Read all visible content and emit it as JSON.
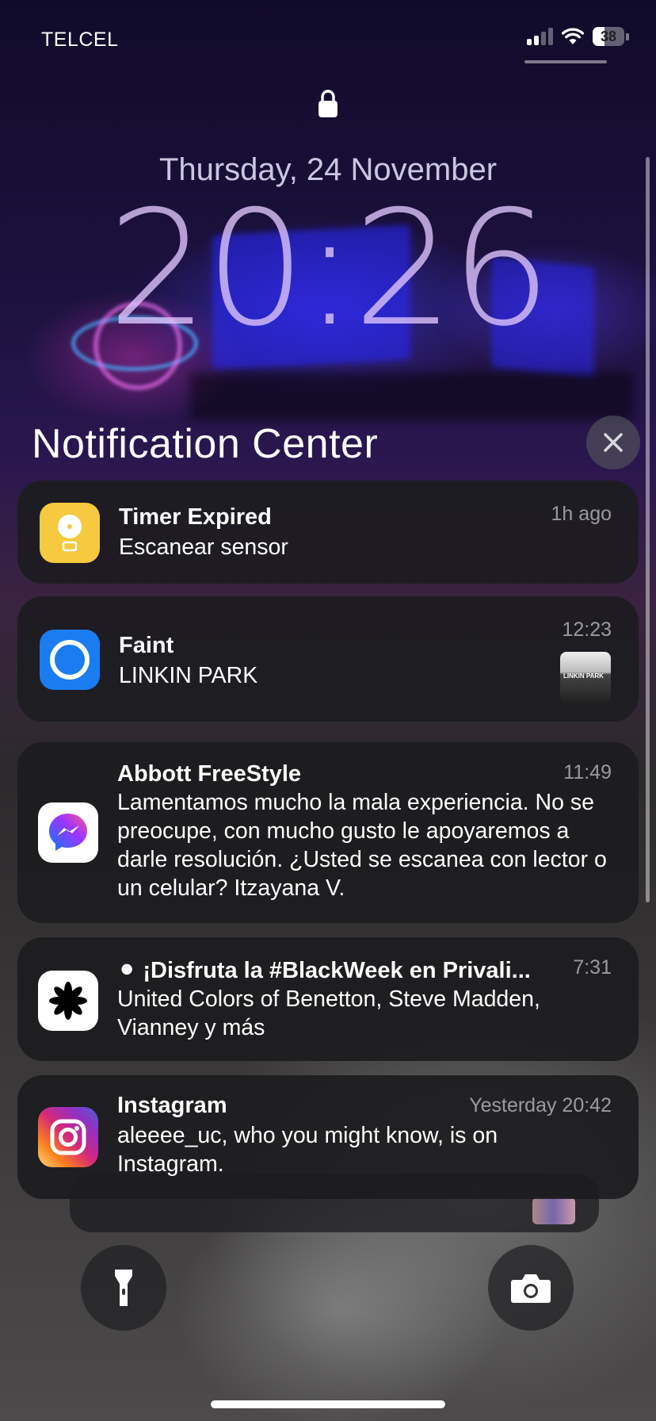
{
  "status_bar": {
    "carrier": "TELCEL",
    "signal_bars": 2,
    "signal_total": 4,
    "battery_level": "38"
  },
  "lock_screen": {
    "date": "Thursday, 24 November",
    "time": "20:26"
  },
  "notification_center": {
    "title": "Notification Center",
    "notifications": [
      {
        "app_icon": "clock-icon",
        "title": "Timer Expired",
        "time": "1h ago",
        "body": "Escanear sensor"
      },
      {
        "app_icon": "shazam-icon",
        "title": "Faint",
        "time": "12:23",
        "body": "LINKIN PARK",
        "thumbnail_text": "LINKIN PARK"
      },
      {
        "app_icon": "messenger-icon",
        "title": "Abbott FreeStyle",
        "time": "11:49",
        "body": "Lamentamos mucho la mala experiencia. No se preocupe, con mucho gusto le apoyaremos a darle resolución.  ¿Usted se escanea con lector o un celular?   Itzayana V."
      },
      {
        "app_icon": "privalia-icon",
        "title": "⚫ ¡Disfruta la #BlackWeek en Privali...",
        "time": "7:31",
        "body": "United Colors of Benetton, Steve Madden, Vianney y más"
      },
      {
        "app_icon": "instagram-icon",
        "title": "Instagram",
        "time": "Yesterday 20:42",
        "body": "aleeee_uc, who you might know, is on Instagram."
      }
    ]
  },
  "colors": {
    "timer_icon_bg": "#F6C93E",
    "shazam_icon_bg": "#1A7CF0",
    "card_bg": "#1C1C20"
  }
}
